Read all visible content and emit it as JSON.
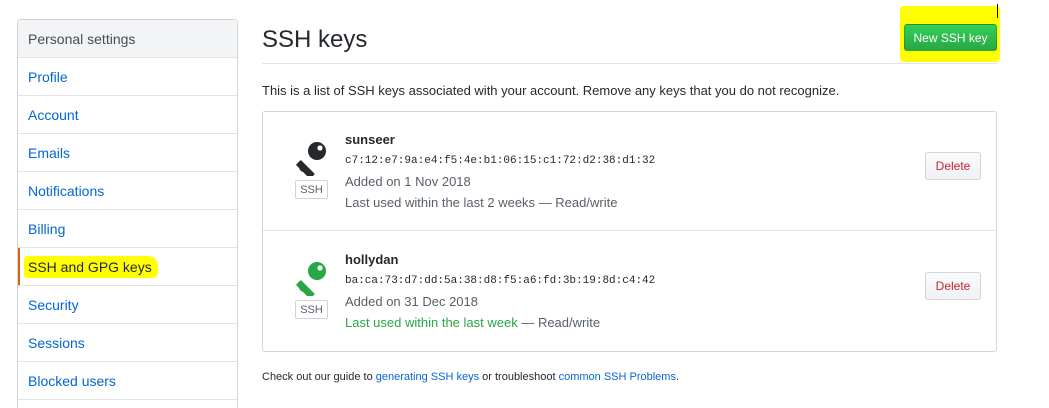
{
  "sidebar": {
    "header": "Personal settings",
    "items": [
      {
        "label": "Profile"
      },
      {
        "label": "Account"
      },
      {
        "label": "Emails"
      },
      {
        "label": "Notifications"
      },
      {
        "label": "Billing"
      },
      {
        "label": "SSH and GPG keys"
      },
      {
        "label": "Security"
      },
      {
        "label": "Sessions"
      },
      {
        "label": "Blocked users"
      }
    ]
  },
  "main": {
    "title": "SSH keys",
    "new_key_label": "New SSH key",
    "intro": "This is a list of SSH keys associated with your account. Remove any keys that you do not recognize.",
    "keys": [
      {
        "name": "sunseer",
        "fingerprint": "c7:12:e7:9a:e4:f5:4e:b1:06:15:c1:72:d2:38:d1:32",
        "added": "Added on 1 Nov 2018",
        "last_used_prefix": "Last used within the last 2 weeks",
        "last_used_suffix": " — Read/write",
        "badge": "SSH",
        "delete_label": "Delete",
        "icon": "key-icon",
        "icon_color": "#24292e"
      },
      {
        "name": "hollydan",
        "fingerprint": "ba:ca:73:d7:dd:5a:38:d8:f5:a6:fd:3b:19:8d:c4:42",
        "added": "Added on 31 Dec 2018",
        "last_used_prefix": "Last used within the last week",
        "last_used_suffix": " — Read/write",
        "badge": "SSH",
        "delete_label": "Delete",
        "icon": "key-icon",
        "icon_color": "#28a745"
      }
    ],
    "footer": {
      "prefix": "Check out our guide to ",
      "link1": "generating SSH keys",
      "middle": " or troubleshoot ",
      "link2": "common SSH Problems",
      "suffix": "."
    }
  },
  "colors": {
    "link": "#0366d6",
    "highlight": "#ffff00",
    "primary_button": "#28a745",
    "danger": "#cb2431"
  }
}
